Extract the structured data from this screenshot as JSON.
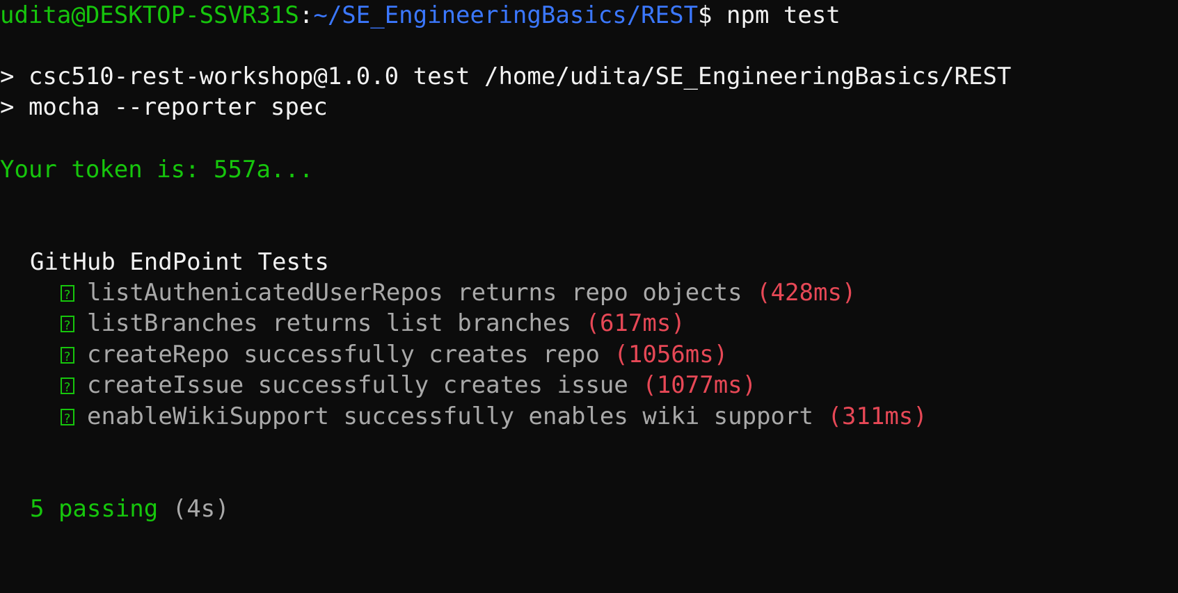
{
  "prompt": {
    "user_host": "udita@DESKTOP-SSVR31S",
    "separator": ":",
    "path": "~/SE_EngineeringBasics/REST",
    "symbol": "$",
    "command": " npm test"
  },
  "npm_output": {
    "line1": "> csc510-rest-workshop@1.0.0 test /home/udita/SE_EngineeringBasics/REST",
    "line2": "> mocha --reporter spec"
  },
  "token_line": "Your token is: 557a...",
  "suite": {
    "title": "GitHub EndPoint Tests",
    "tests": [
      {
        "name": "listAuthenicatedUserRepos returns repo objects",
        "duration": "(428ms)"
      },
      {
        "name": "listBranches returns list branches",
        "duration": "(617ms)"
      },
      {
        "name": "createRepo successfully creates repo",
        "duration": "(1056ms)"
      },
      {
        "name": "createIssue successfully creates issue",
        "duration": "(1077ms)"
      },
      {
        "name": "enableWikiSupport successfully enables wiki support",
        "duration": "(311ms)"
      }
    ]
  },
  "summary": {
    "passing": "5 passing",
    "time": "(4s)"
  },
  "colors": {
    "background": "#0c0c0c",
    "green": "#16c60c",
    "blue": "#3b78ff",
    "red": "#e74856",
    "text": "#f2f2f2",
    "muted": "#cccccc"
  }
}
